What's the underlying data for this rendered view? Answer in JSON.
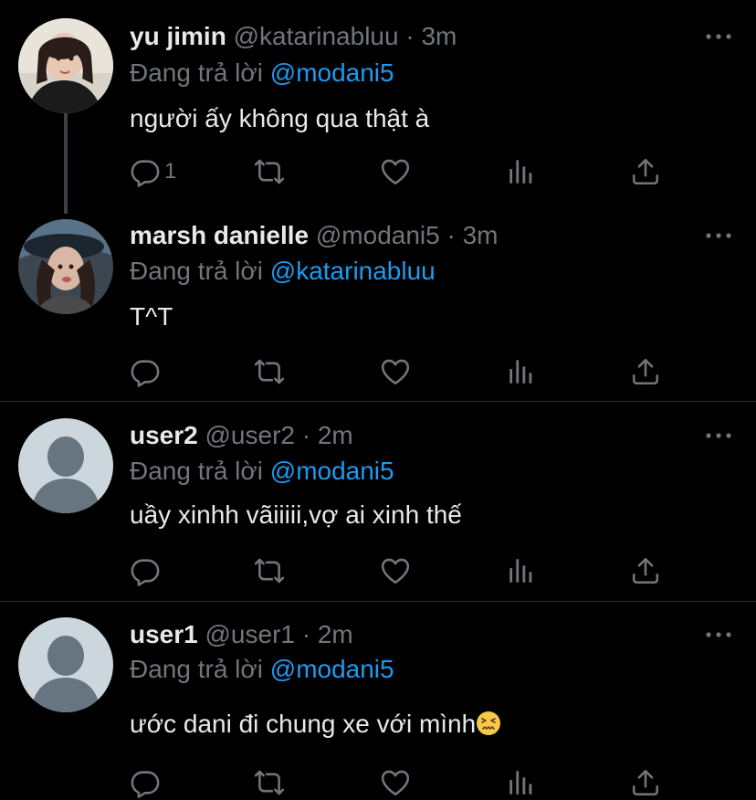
{
  "reply_prefix": "Đang trả lời",
  "colors": {
    "background": "#000000",
    "text": "#e7e9ea",
    "muted": "#71767b",
    "mention": "#1d9bf0",
    "divider": "#2f3336"
  },
  "icons": {
    "more": "more-dots-icon",
    "reply": "reply-bubble-icon",
    "retweet": "retweet-icon",
    "like": "heart-icon",
    "views": "analytics-icon",
    "share": "share-icon"
  },
  "tweets": [
    {
      "name": "yu jimin",
      "handle": "@katarinabluu",
      "sep": "·",
      "time": "3m",
      "reply_to": "@modani5",
      "text": "người ấy không qua thật à",
      "reply_count": "1"
    },
    {
      "name": "marsh danielle",
      "handle": "@modani5",
      "sep": "·",
      "time": "3m",
      "reply_to": "@katarinabluu",
      "text": "T^T",
      "reply_count": ""
    },
    {
      "name": "user2",
      "handle": "@user2",
      "sep": "·",
      "time": "2m",
      "reply_to": "@modani5",
      "text": "uầy xinhh vãiiiii,vợ ai xinh thế",
      "reply_count": ""
    },
    {
      "name": "user1",
      "handle": "@user1",
      "sep": "·",
      "time": "2m",
      "reply_to": "@modani5",
      "text": "ước dani đi chung xe với mình",
      "reply_count": ""
    }
  ]
}
